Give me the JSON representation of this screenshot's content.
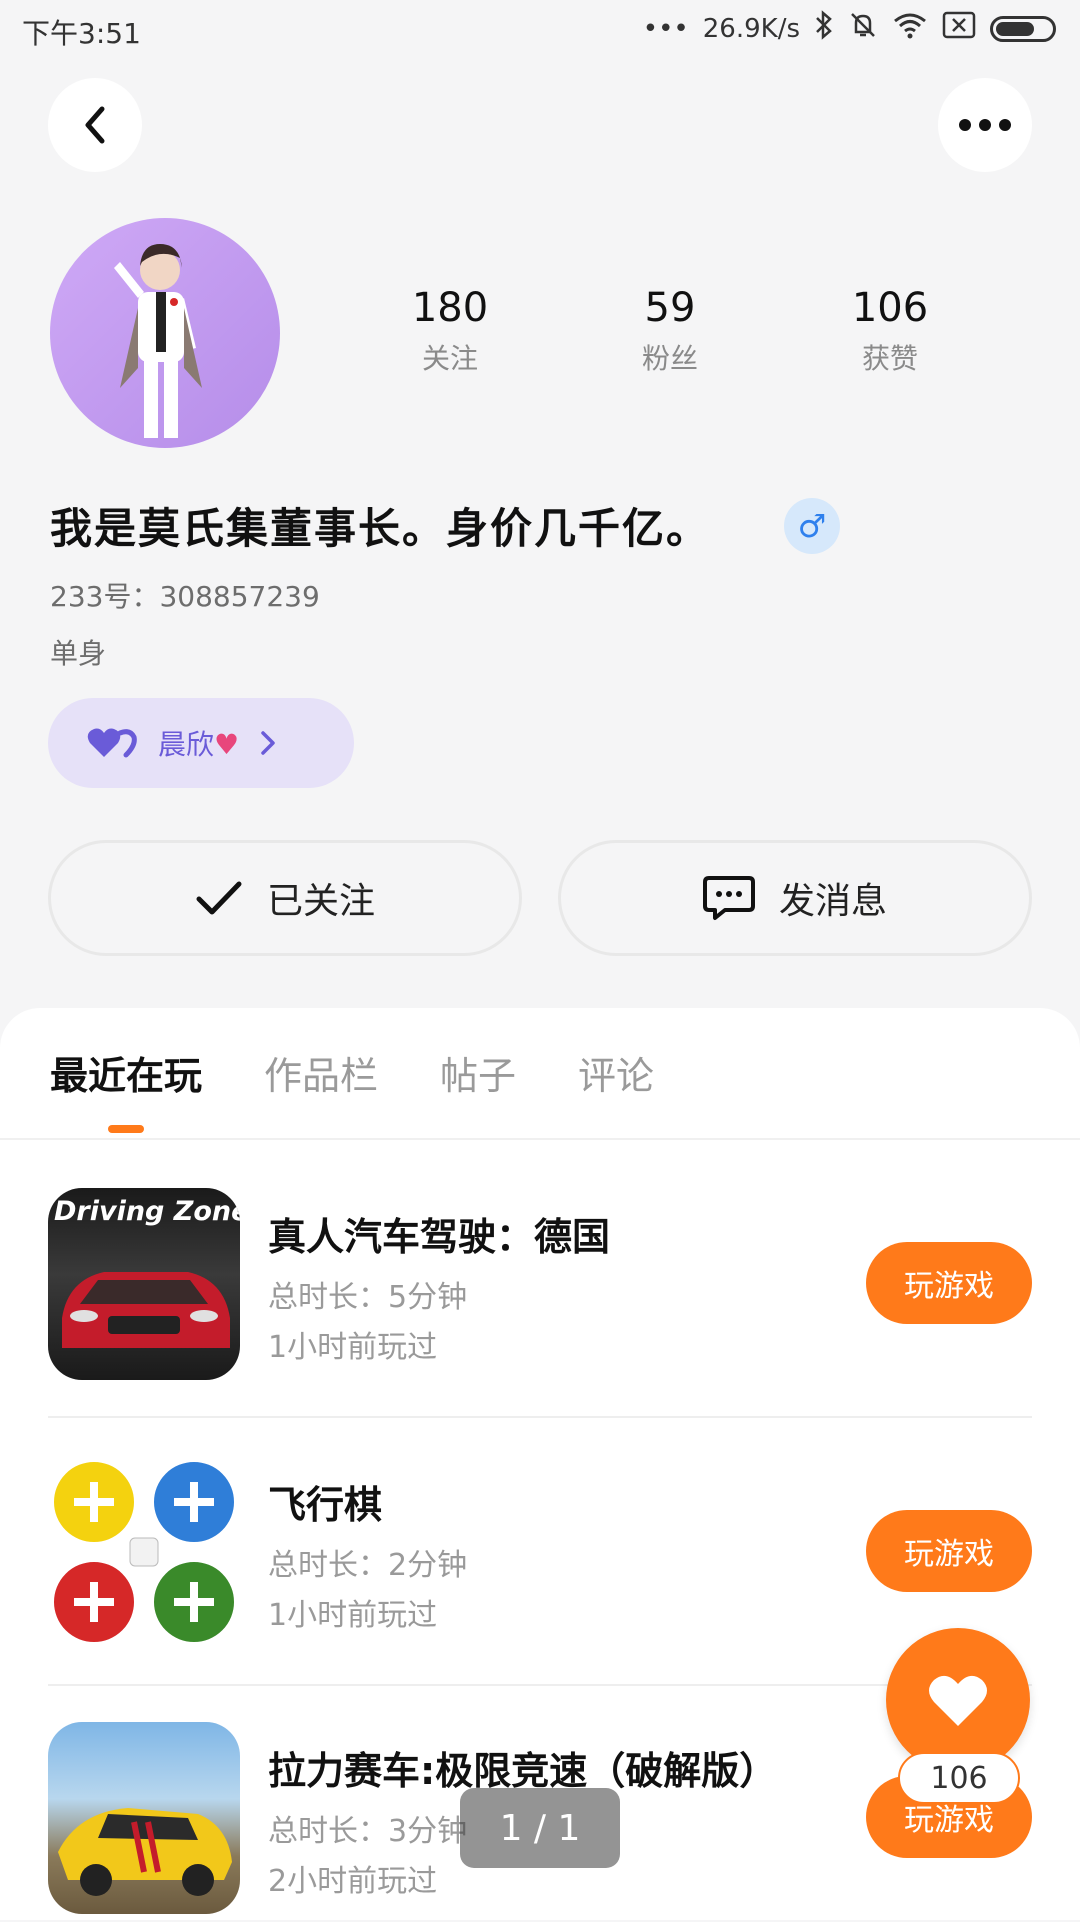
{
  "status_bar": {
    "time": "下午3:51",
    "network_speed": "26.9K/s",
    "icons": [
      "dots-icon",
      "bluetooth-icon",
      "bell-off-icon",
      "wifi-icon",
      "sim-x-icon",
      "battery-icon"
    ],
    "battery_level": 0.7
  },
  "header": {
    "back_icon": "chevron-left-icon",
    "more_icon": "more-dots-icon"
  },
  "profile": {
    "stats": [
      {
        "value": "180",
        "label": "关注"
      },
      {
        "value": "59",
        "label": "粉丝"
      },
      {
        "value": "106",
        "label": "获赞"
      }
    ],
    "username": "我是莫氏集董事长。身价几千亿。",
    "gender_symbol": "♂",
    "user_id": "233号：308857239",
    "relationship_status": "单身",
    "cp_name": "晨欣",
    "follow_label": "已关注",
    "message_label": "发消息"
  },
  "tabs": [
    {
      "label": "最近在玩",
      "active": true
    },
    {
      "label": "作品栏",
      "active": false
    },
    {
      "label": "帖子",
      "active": false
    },
    {
      "label": "评论",
      "active": false
    }
  ],
  "games": [
    {
      "title": "真人汽车驾驶：德国",
      "duration": "总时长：5分钟",
      "last_played": "1小时前玩过",
      "play_label": "玩游戏",
      "icon_text": "Driving Zone"
    },
    {
      "title": "飞行棋",
      "duration": "总时长：2分钟",
      "last_played": "1小时前玩过",
      "play_label": "玩游戏"
    },
    {
      "title": "拉力赛车:极限竞速（破解版）",
      "duration": "总时长：3分钟",
      "last_played": "2小时前玩过",
      "play_label": "玩游戏"
    }
  ],
  "like_fab": {
    "count": "106"
  },
  "page_indicator": "1 / 1",
  "colors": {
    "accent": "#ff7a1a",
    "background": "#f5f5f6",
    "gender_blue": "#2f80ed",
    "cp_purple": "#6a5bd8"
  }
}
